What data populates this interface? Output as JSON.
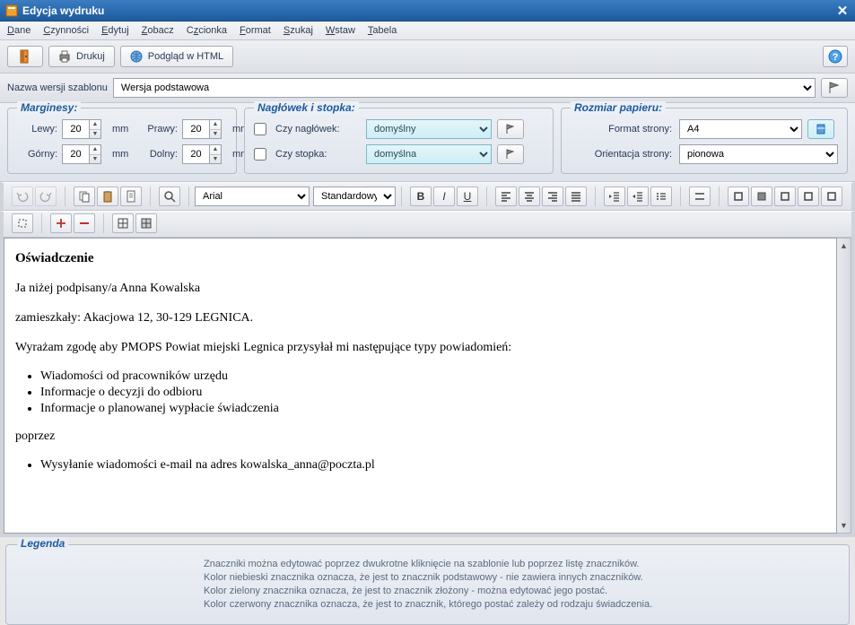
{
  "window": {
    "title": "Edycja wydruku"
  },
  "menu": {
    "dane": "Dane",
    "czynnosci": "Czynności",
    "edytuj": "Edytuj",
    "zobacz": "Zobacz",
    "czcionka": "Czcionka",
    "format": "Format",
    "szukaj": "Szukaj",
    "wstaw": "Wstaw",
    "tabela": "Tabela"
  },
  "toolbar": {
    "drukuj": "Drukuj",
    "podglad": "Podgląd w HTML"
  },
  "template": {
    "label": "Nazwa wersji szablonu",
    "value": "Wersja podstawowa"
  },
  "margins": {
    "title": "Marginesy:",
    "left_label": "Lewy:",
    "left": "20",
    "right_label": "Prawy:",
    "right": "20",
    "top_label": "Górny:",
    "top": "20",
    "bottom_label": "Dolny:",
    "bottom": "20",
    "unit": "mm"
  },
  "headerfooter": {
    "title": "Nagłówek i stopka:",
    "header_label": "Czy nagłówek:",
    "header_value": "domyślny",
    "footer_label": "Czy stopka:",
    "footer_value": "domyślna"
  },
  "paper": {
    "title": "Rozmiar papieru:",
    "format_label": "Format strony:",
    "format_value": "A4",
    "orient_label": "Orientacja strony:",
    "orient_value": "pionowa"
  },
  "format_toolbar": {
    "font": "Arial",
    "style": "Standardowy"
  },
  "document": {
    "heading": "Oświadczenie",
    "p1": "Ja niżej podpisany/a Anna Kowalska",
    "p2": "zamieszkały: Akacjowa 12, 30-129 LEGNICA.",
    "p3": "Wyrażam zgodę aby PMOPS Powiat miejski Legnica przysyłał mi następujące typy powiadomień:",
    "l1": "Wiadomości od pracowników urzędu",
    "l2": "Informacje o decyzji do odbioru",
    "l3": "Informacje o planowanej wypłacie świadczenia",
    "p4": "poprzez",
    "l4": "Wysyłanie wiadomości e-mail na adres kowalska_anna@poczta.pl"
  },
  "legend": {
    "title": "Legenda",
    "line1": "Znaczniki można edytować poprzez dwukrotne kliknięcie na szablonie lub poprzez listę znaczników.",
    "line2": "Kolor niebieski znacznika oznacza, że jest to znacznik podstawowy - nie zawiera innych znaczników.",
    "line3": "Kolor zielony znacznika oznacza, że jest to znacznik złożony - można edytować jego postać.",
    "line4": "Kolor czerwony znacznika oznacza, że jest to znacznik, którego postać zależy od rodzaju świadczenia."
  }
}
